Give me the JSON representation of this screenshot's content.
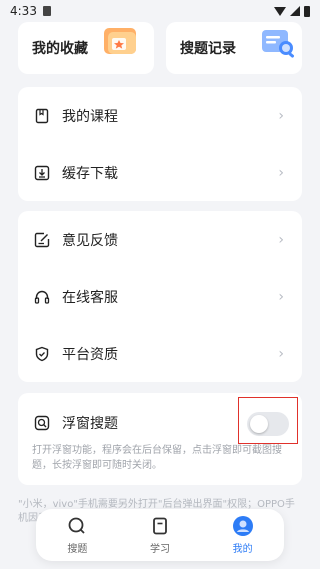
{
  "status_bar": {
    "time": "4:33"
  },
  "top_cards": {
    "favorites": "我的收藏",
    "search_history": "搜题记录"
  },
  "menu_group_1": [
    {
      "label": "我的课程",
      "icon": "book-icon"
    },
    {
      "label": "缓存下载",
      "icon": "download-icon"
    }
  ],
  "menu_group_2": [
    {
      "label": "意见反馈",
      "icon": "feedback-icon"
    },
    {
      "label": "在线客服",
      "icon": "headset-icon"
    },
    {
      "label": "平台资质",
      "icon": "shield-icon"
    }
  ],
  "floating_search": {
    "label": "浮窗搜题",
    "toggle_on": false,
    "description": "打开浮窗功能，程序会在后台保留，点击浮窗即可截图搜题，长按浮窗即可随时关闭。"
  },
  "footer_note": "\"小米，vivo\"手机需要另外打开\"后台弹出界面\"权限；OPPO手机因系统限制……",
  "tabbar": {
    "items": [
      {
        "label": "搜题",
        "icon": "search-icon"
      },
      {
        "label": "学习",
        "icon": "study-icon"
      },
      {
        "label": "我的",
        "icon": "profile-icon"
      }
    ],
    "active_index": 2
  },
  "colors": {
    "accent": "#2d7cf6",
    "highlight": "#e0312b"
  }
}
